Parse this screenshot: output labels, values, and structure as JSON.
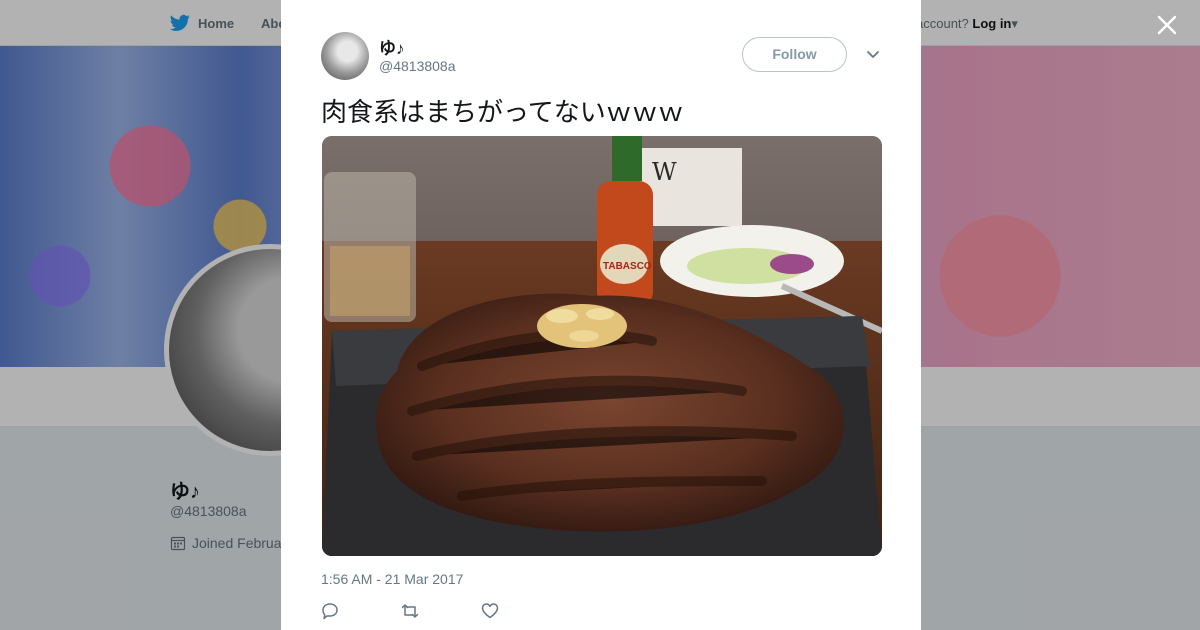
{
  "nav": {
    "home_label": "Home",
    "about_label": "Abo",
    "account_label": "account?",
    "login_label": "Log in"
  },
  "profile": {
    "name": "ゆ♪",
    "handle": "@4813808a",
    "joined": "Joined Februa"
  },
  "tweet": {
    "author_name": "ゆ♪",
    "author_handle": "@4813808a",
    "follow_label": "Follow",
    "text": "肉食系はまちがってないｗｗｗ",
    "timestamp": "1:56 AM - 21 Mar 2017"
  },
  "photo_labels": {
    "sauce": "TABASCO",
    "sign": "W"
  },
  "icons": {
    "close": "close-icon",
    "twitter": "twitter-bird-icon",
    "caret": "chevron-down-icon",
    "reply": "reply-icon",
    "retweet": "retweet-icon",
    "like": "heart-icon",
    "calendar": "calendar-icon"
  },
  "colors": {
    "twitter_blue": "#1da1f2",
    "text": "#14171a",
    "muted": "#657786",
    "border": "#e1e8ed"
  }
}
